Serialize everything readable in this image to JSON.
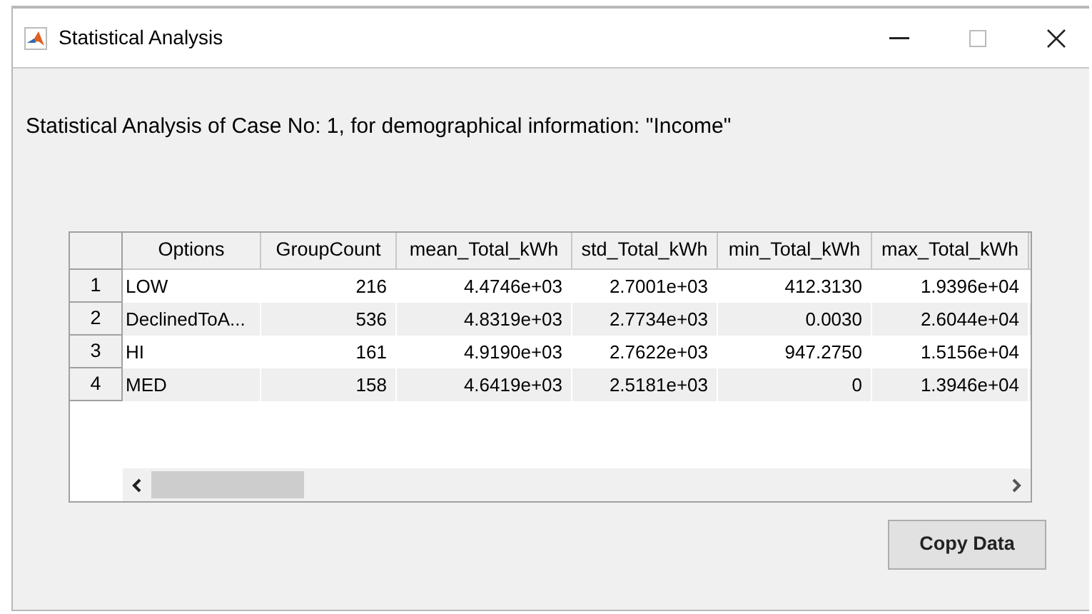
{
  "window": {
    "title": "Statistical Analysis"
  },
  "heading": "Statistical Analysis of Case No: 1, for demographical information: \"Income\"",
  "table": {
    "columns": [
      "Options",
      "GroupCount",
      "mean_Total_kWh",
      "std_Total_kWh",
      "min_Total_kWh",
      "max_Total_kWh"
    ],
    "rows": [
      {
        "index": "1",
        "cells": [
          "LOW",
          "216",
          "4.4746e+03",
          "2.7001e+03",
          "412.3130",
          "1.9396e+04"
        ]
      },
      {
        "index": "2",
        "cells": [
          "DeclinedToA...",
          "536",
          "4.8319e+03",
          "2.7734e+03",
          "0.0030",
          "2.6044e+04"
        ]
      },
      {
        "index": "3",
        "cells": [
          "HI",
          "161",
          "4.9190e+03",
          "2.7622e+03",
          "947.2750",
          "1.5156e+04"
        ]
      },
      {
        "index": "4",
        "cells": [
          "MED",
          "158",
          "4.6419e+03",
          "2.5181e+03",
          "0",
          "1.3946e+04"
        ]
      }
    ]
  },
  "buttons": [
    "Copy Data"
  ]
}
